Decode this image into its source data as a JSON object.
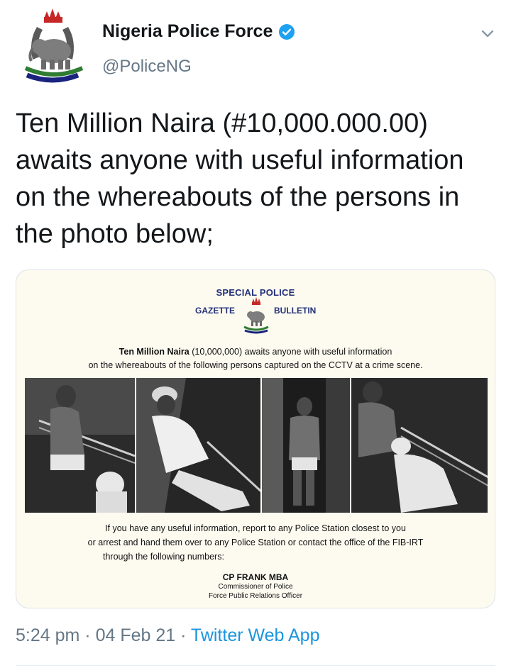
{
  "tweet": {
    "author_name": "Nigeria Police Force",
    "author_handle": "@PoliceNG",
    "text": "Ten Million Naira (#10,000.000.00) awaits anyone with useful information on the whereabouts of the persons in the photo below;",
    "time": "5:24 pm",
    "date": "04 Feb 21",
    "source": "Twitter Web App",
    "separator": " · "
  },
  "colors": {
    "verified": "#1da1f2",
    "secondary_text": "#657786",
    "link": "#1b95e0",
    "gazette_blue": "#23307a",
    "card_bg": "#fdfbf0"
  },
  "icons": {
    "avatar": "police-crest-icon",
    "verified": "verified-badge-icon",
    "menu": "chevron-down-icon"
  },
  "gazette": {
    "title": "SPECIAL POLICE",
    "left_label": "GAZETTE",
    "right_label": "BULLETIN",
    "notice_bold": "Ten Million Naira",
    "notice_rest": " (10,000,000) awaits anyone with useful information",
    "notice_line2": "on the whereabouts of the following persons captured on the CCTV at a crime scene.",
    "instruction_1": "If you have any useful information, report to any Police Station closest to you",
    "instruction_2": "or arrest and hand them over to any Police Station or contact the office of the FIB-IRT",
    "instruction_3": "through the following numbers:",
    "signatory_name": "CP FRANK MBA",
    "signatory_title_1": "Commissioner of Police",
    "signatory_title_2": "Force Public Relations Officer"
  }
}
